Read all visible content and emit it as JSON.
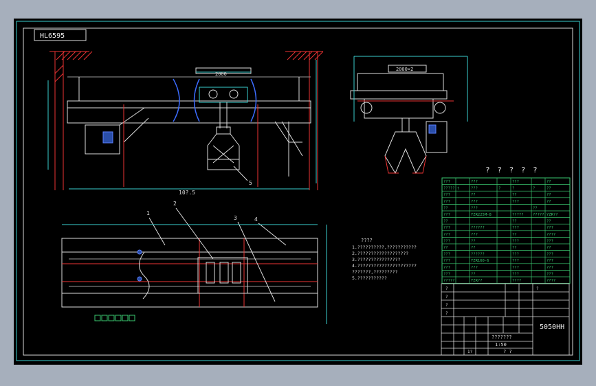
{
  "drawing": {
    "id_tag": "HL6595",
    "title_heading": "? ? ? ? ?",
    "span_dim": "10?.5",
    "top_dim": "2000",
    "side_top_dim": "2000×2",
    "drawing_number": "5050HH",
    "notes": {
      "heading": "????",
      "lines": [
        "1.??????????,???????????",
        "2.???????????????????",
        "3.????????????????",
        "4.??????????????????????",
        "  ???????,?????????",
        "5.???????????"
      ]
    },
    "callouts": [
      "1",
      "2",
      "3",
      "4",
      "5"
    ],
    "spec_table": {
      "rows": [
        [
          "???",
          "",
          "???",
          "",
          "???",
          "",
          "??"
        ],
        [
          "?????",
          "t",
          "???",
          "?",
          "?",
          "?",
          "??"
        ],
        [
          "???",
          "",
          "??",
          "",
          "??",
          "",
          "??"
        ],
        [
          "???",
          "",
          "???",
          "",
          "???",
          "",
          "??"
        ],
        [
          "??",
          "",
          "???",
          "",
          "",
          "??",
          ""
        ],
        [
          "???",
          "",
          "YZR225M-8",
          "",
          "?????",
          "?????",
          "YZR??"
        ],
        [
          "??",
          "",
          "",
          "",
          "??",
          "",
          "??"
        ],
        [
          "???",
          "",
          "??????",
          "",
          "???",
          "",
          "???"
        ],
        [
          "???",
          "",
          "???",
          "",
          "??",
          "",
          "????"
        ],
        [
          "???",
          "",
          "??",
          "",
          "???",
          "",
          "???"
        ],
        [
          "??",
          "",
          "??",
          "",
          "??",
          "",
          "??"
        ],
        [
          "???",
          "",
          "??????",
          "",
          "???",
          "",
          "???"
        ],
        [
          "???",
          "",
          "YZR160-6",
          "",
          "???",
          "",
          "???"
        ],
        [
          "???",
          "",
          "???",
          "",
          "???",
          "",
          "???"
        ],
        [
          "???",
          "",
          "??",
          "",
          "???",
          "",
          "???"
        ],
        [
          "?????",
          "",
          "YZR??",
          "",
          "????",
          "",
          "????"
        ]
      ]
    },
    "title_block": {
      "rows_top": [
        "?",
        "?",
        "?",
        "?",
        "?"
      ],
      "scale": "1:50",
      "sheet": "? ?",
      "part_name": "???????",
      "weight": "1?"
    }
  }
}
